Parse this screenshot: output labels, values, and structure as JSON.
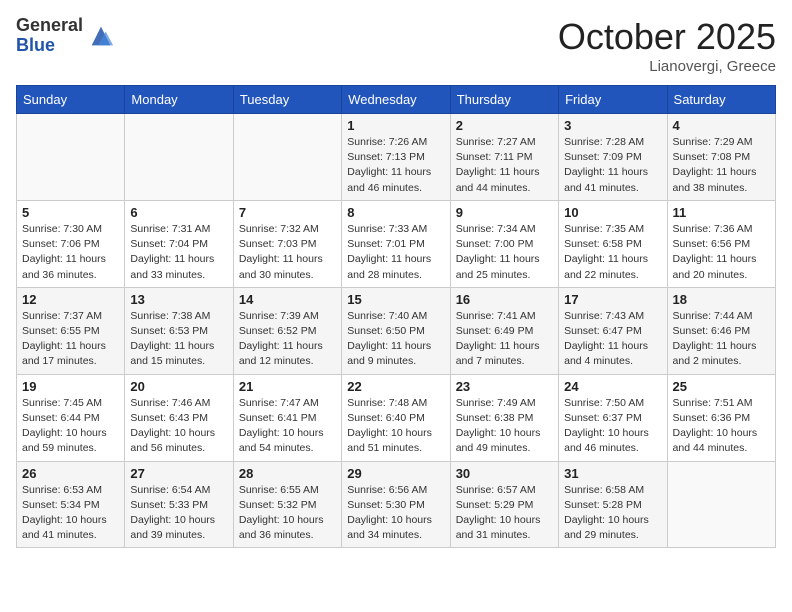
{
  "header": {
    "logo_general": "General",
    "logo_blue": "Blue",
    "month_title": "October 2025",
    "location": "Lianovergi, Greece"
  },
  "calendar": {
    "days_of_week": [
      "Sunday",
      "Monday",
      "Tuesday",
      "Wednesday",
      "Thursday",
      "Friday",
      "Saturday"
    ],
    "weeks": [
      [
        {
          "day": "",
          "info": ""
        },
        {
          "day": "",
          "info": ""
        },
        {
          "day": "",
          "info": ""
        },
        {
          "day": "1",
          "info": "Sunrise: 7:26 AM\nSunset: 7:13 PM\nDaylight: 11 hours and 46 minutes."
        },
        {
          "day": "2",
          "info": "Sunrise: 7:27 AM\nSunset: 7:11 PM\nDaylight: 11 hours and 44 minutes."
        },
        {
          "day": "3",
          "info": "Sunrise: 7:28 AM\nSunset: 7:09 PM\nDaylight: 11 hours and 41 minutes."
        },
        {
          "day": "4",
          "info": "Sunrise: 7:29 AM\nSunset: 7:08 PM\nDaylight: 11 hours and 38 minutes."
        }
      ],
      [
        {
          "day": "5",
          "info": "Sunrise: 7:30 AM\nSunset: 7:06 PM\nDaylight: 11 hours and 36 minutes."
        },
        {
          "day": "6",
          "info": "Sunrise: 7:31 AM\nSunset: 7:04 PM\nDaylight: 11 hours and 33 minutes."
        },
        {
          "day": "7",
          "info": "Sunrise: 7:32 AM\nSunset: 7:03 PM\nDaylight: 11 hours and 30 minutes."
        },
        {
          "day": "8",
          "info": "Sunrise: 7:33 AM\nSunset: 7:01 PM\nDaylight: 11 hours and 28 minutes."
        },
        {
          "day": "9",
          "info": "Sunrise: 7:34 AM\nSunset: 7:00 PM\nDaylight: 11 hours and 25 minutes."
        },
        {
          "day": "10",
          "info": "Sunrise: 7:35 AM\nSunset: 6:58 PM\nDaylight: 11 hours and 22 minutes."
        },
        {
          "day": "11",
          "info": "Sunrise: 7:36 AM\nSunset: 6:56 PM\nDaylight: 11 hours and 20 minutes."
        }
      ],
      [
        {
          "day": "12",
          "info": "Sunrise: 7:37 AM\nSunset: 6:55 PM\nDaylight: 11 hours and 17 minutes."
        },
        {
          "day": "13",
          "info": "Sunrise: 7:38 AM\nSunset: 6:53 PM\nDaylight: 11 hours and 15 minutes."
        },
        {
          "day": "14",
          "info": "Sunrise: 7:39 AM\nSunset: 6:52 PM\nDaylight: 11 hours and 12 minutes."
        },
        {
          "day": "15",
          "info": "Sunrise: 7:40 AM\nSunset: 6:50 PM\nDaylight: 11 hours and 9 minutes."
        },
        {
          "day": "16",
          "info": "Sunrise: 7:41 AM\nSunset: 6:49 PM\nDaylight: 11 hours and 7 minutes."
        },
        {
          "day": "17",
          "info": "Sunrise: 7:43 AM\nSunset: 6:47 PM\nDaylight: 11 hours and 4 minutes."
        },
        {
          "day": "18",
          "info": "Sunrise: 7:44 AM\nSunset: 6:46 PM\nDaylight: 11 hours and 2 minutes."
        }
      ],
      [
        {
          "day": "19",
          "info": "Sunrise: 7:45 AM\nSunset: 6:44 PM\nDaylight: 10 hours and 59 minutes."
        },
        {
          "day": "20",
          "info": "Sunrise: 7:46 AM\nSunset: 6:43 PM\nDaylight: 10 hours and 56 minutes."
        },
        {
          "day": "21",
          "info": "Sunrise: 7:47 AM\nSunset: 6:41 PM\nDaylight: 10 hours and 54 minutes."
        },
        {
          "day": "22",
          "info": "Sunrise: 7:48 AM\nSunset: 6:40 PM\nDaylight: 10 hours and 51 minutes."
        },
        {
          "day": "23",
          "info": "Sunrise: 7:49 AM\nSunset: 6:38 PM\nDaylight: 10 hours and 49 minutes."
        },
        {
          "day": "24",
          "info": "Sunrise: 7:50 AM\nSunset: 6:37 PM\nDaylight: 10 hours and 46 minutes."
        },
        {
          "day": "25",
          "info": "Sunrise: 7:51 AM\nSunset: 6:36 PM\nDaylight: 10 hours and 44 minutes."
        }
      ],
      [
        {
          "day": "26",
          "info": "Sunrise: 6:53 AM\nSunset: 5:34 PM\nDaylight: 10 hours and 41 minutes."
        },
        {
          "day": "27",
          "info": "Sunrise: 6:54 AM\nSunset: 5:33 PM\nDaylight: 10 hours and 39 minutes."
        },
        {
          "day": "28",
          "info": "Sunrise: 6:55 AM\nSunset: 5:32 PM\nDaylight: 10 hours and 36 minutes."
        },
        {
          "day": "29",
          "info": "Sunrise: 6:56 AM\nSunset: 5:30 PM\nDaylight: 10 hours and 34 minutes."
        },
        {
          "day": "30",
          "info": "Sunrise: 6:57 AM\nSunset: 5:29 PM\nDaylight: 10 hours and 31 minutes."
        },
        {
          "day": "31",
          "info": "Sunrise: 6:58 AM\nSunset: 5:28 PM\nDaylight: 10 hours and 29 minutes."
        },
        {
          "day": "",
          "info": ""
        }
      ]
    ]
  }
}
